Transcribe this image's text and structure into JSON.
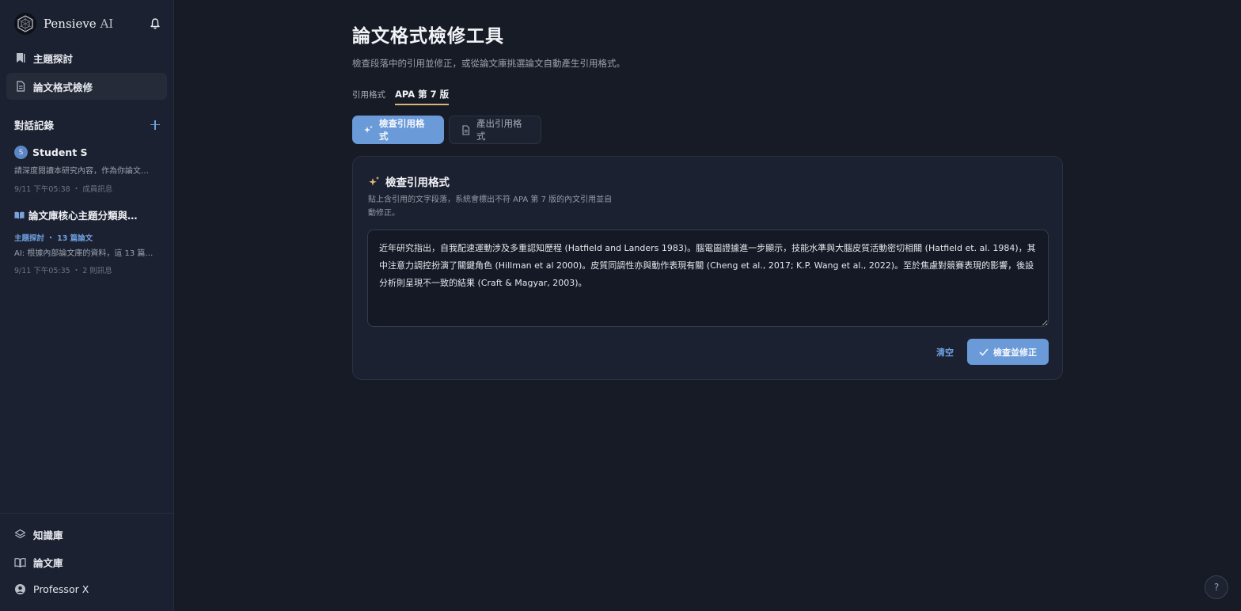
{
  "brand": {
    "name": "Pensieve",
    "suffix": "AI"
  },
  "sidebar": {
    "nav": [
      {
        "label": "主題探討",
        "icon": "bookmark-icon",
        "active": false
      },
      {
        "label": "論文格式檢修",
        "icon": "document-icon",
        "active": true
      }
    ],
    "history_title": "對話記錄",
    "conversations": [
      {
        "avatar": "S",
        "title": "Student S",
        "snippet": "請深度閱讀本研究內容，作為你論文…",
        "meta": "9/11 下午05:38 ・ 成員訊息"
      },
      {
        "title": "論文庫核心主題分類與…",
        "tag": "主題探討 ・ 13 篇論文",
        "snippet": "AI: 根據內部論文庫的資料，這 13 篇…",
        "meta": "9/11 下午05:35 ・ 2 則訊息"
      }
    ],
    "bottom": [
      {
        "label": "知識庫",
        "icon": "layers-icon"
      },
      {
        "label": "論文庫",
        "icon": "open-book-icon"
      },
      {
        "label": "Professor X",
        "icon": "user-icon"
      }
    ]
  },
  "main": {
    "title": "論文格式檢修工具",
    "subtitle": "檢查段落中的引用並修正，或從論文庫挑選論文自動產生引用格式。",
    "style_label": "引用格式",
    "style_value": "APA 第 7 版",
    "tabs": [
      {
        "label": "檢查引用格式",
        "icon": "sparkle-icon"
      },
      {
        "label": "產出引用格式",
        "icon": "document-icon"
      }
    ],
    "card": {
      "title": "檢查引用格式",
      "description": "貼上含引用的文字段落，系統會標出不符 APA 第 7 版的內文引用並自動修正。",
      "text": "近年研究指出，自我配速運動涉及多重認知歷程 (Hatfield and Landers 1983)。腦電圖證據進一步顯示，技能水準與大腦皮質活動密切相關 (Hatfield et. al. 1984)，其中注意力調控扮演了關鍵角色 (Hillman et al 2000)。皮質同調性亦與動作表現有關 (Cheng et al., 2017; K.P. Wang et al., 2022)。至於焦慮對競賽表現的影響，後設分析則呈現不一致的結果 (Craft & Magyar, 2003)。",
      "clear_label": "清空",
      "submit_label": "檢查並修正"
    },
    "help_label": "?"
  },
  "colors": {
    "accent": "#6a9ad8",
    "link": "#6f9fe0",
    "underline": "#d7b47c",
    "sparkle": "#e0b87a"
  }
}
